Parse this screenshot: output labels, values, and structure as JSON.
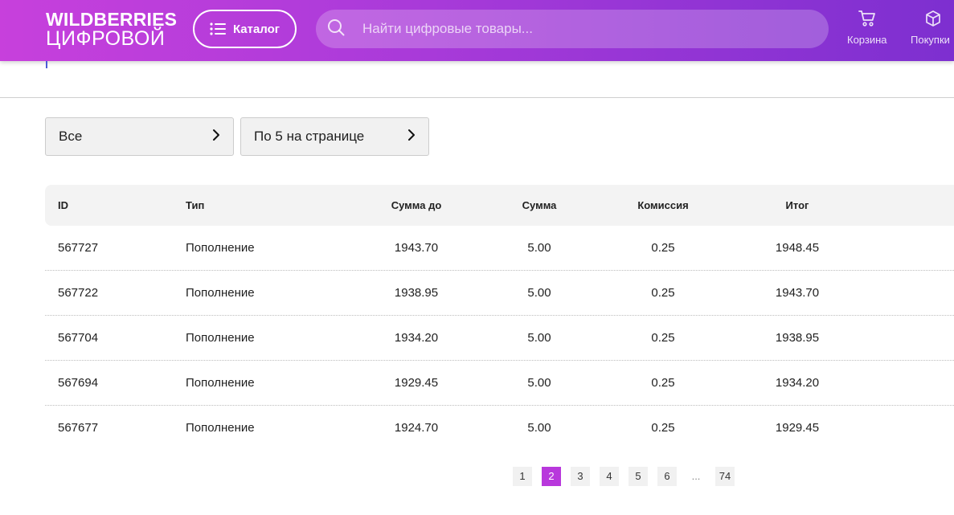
{
  "header": {
    "logo_top": "WILDBERRIES",
    "logo_bottom": "ЦИФРОВОЙ",
    "catalog_label": "Каталог",
    "search_placeholder": "Найти цифровые товары...",
    "cart_label": "Корзина",
    "purchases_label": "Покупки"
  },
  "filters": {
    "type_value": "Все",
    "per_page_value": "По 5 на странице"
  },
  "table": {
    "headers": {
      "id": "ID",
      "type": "Тип",
      "before": "Сумма до",
      "sum": "Сумма",
      "fee": "Комиссия",
      "total": "Итог"
    },
    "rows": [
      {
        "id": "567727",
        "type": "Пополнение",
        "before": "1943.70",
        "sum": "5.00",
        "fee": "0.25",
        "total": "1948.45"
      },
      {
        "id": "567722",
        "type": "Пополнение",
        "before": "1938.95",
        "sum": "5.00",
        "fee": "0.25",
        "total": "1943.70"
      },
      {
        "id": "567704",
        "type": "Пополнение",
        "before": "1934.20",
        "sum": "5.00",
        "fee": "0.25",
        "total": "1938.95"
      },
      {
        "id": "567694",
        "type": "Пополнение",
        "before": "1929.45",
        "sum": "5.00",
        "fee": "0.25",
        "total": "1934.20"
      },
      {
        "id": "567677",
        "type": "Пополнение",
        "before": "1924.70",
        "sum": "5.00",
        "fee": "0.25",
        "total": "1929.45"
      }
    ]
  },
  "pagination": {
    "pages": [
      "1",
      "2",
      "3",
      "4",
      "5",
      "6",
      "...",
      "74"
    ],
    "current": "2"
  },
  "colors": {
    "accent": "#b838dc",
    "header_start": "#c740dc",
    "header_end": "#7d2fd0"
  },
  "icons": {
    "catalog": "list-icon",
    "search": "search-icon",
    "cart": "cart-icon",
    "purchases": "box-icon",
    "chevron": "chevron-right-icon"
  }
}
